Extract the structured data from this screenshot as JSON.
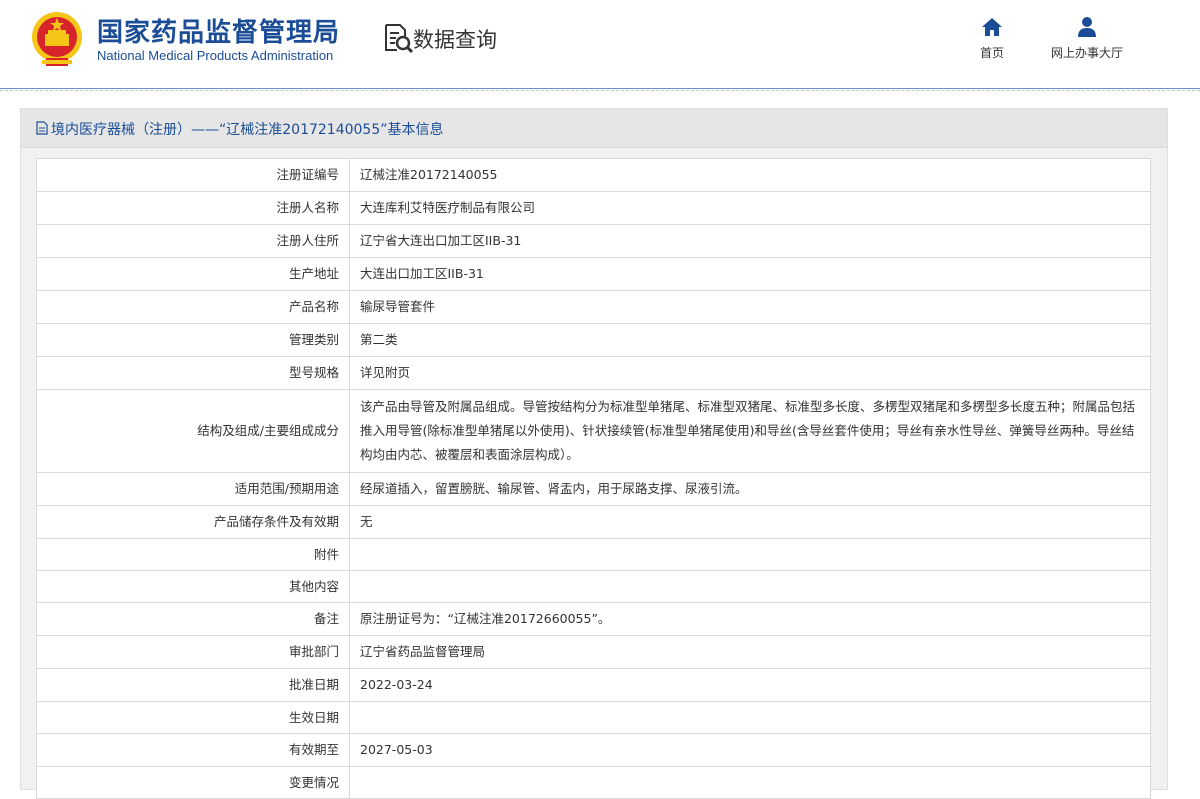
{
  "header": {
    "org_name_cn": "国家药品监督管理局",
    "org_name_en": "National Medical Products Administration",
    "section_title": "数据查询",
    "nav": [
      {
        "label": "首页",
        "icon": "home-icon"
      },
      {
        "label": "网上办事大厅",
        "icon": "user-icon"
      }
    ],
    "colors": {
      "brand": "#1b4d97",
      "emblem_red": "#d8232a",
      "emblem_gold": "#f5c518"
    }
  },
  "panel": {
    "title": "境内医疗器械（注册）——“辽械注准20172140055”基本信息",
    "rows": [
      {
        "label": "注册证编号",
        "value": "辽械注准20172140055"
      },
      {
        "label": "注册人名称",
        "value": "大连库利艾特医疗制品有限公司"
      },
      {
        "label": "注册人住所",
        "value": "辽宁省大连出口加工区IIB-31"
      },
      {
        "label": "生产地址",
        "value": "大连出口加工区IIB-31"
      },
      {
        "label": "产品名称",
        "value": "输尿导管套件"
      },
      {
        "label": "管理类别",
        "value": "第二类"
      },
      {
        "label": "型号规格",
        "value": "详见附页"
      },
      {
        "label": "结构及组成/主要组成成分",
        "value": "该产品由导管及附属品组成。导管按结构分为标准型单猪尾、标准型双猪尾、标准型多长度、多楞型双猪尾和多楞型多长度五种；附属品包括推入用导管(除标准型单猪尾以外使用)、针状接续管(标准型单猪尾使用)和导丝(含导丝套件使用；导丝有亲水性导丝、弹簧导丝两种。导丝结构均由内芯、被覆层和表面涂层构成）。"
      },
      {
        "label": "适用范围/预期用途",
        "value": "经尿道插入，留置膀胱、输尿管、肾盂内，用于尿路支撑、尿液引流。"
      },
      {
        "label": "产品储存条件及有效期",
        "value": "无"
      },
      {
        "label": "附件",
        "value": ""
      },
      {
        "label": "其他内容",
        "value": ""
      },
      {
        "label": "备注",
        "value": "原注册证号为：“辽械注准20172660055”。"
      },
      {
        "label": "审批部门",
        "value": "辽宁省药品监督管理局"
      },
      {
        "label": "批准日期",
        "value": "2022-03-24"
      },
      {
        "label": "生效日期",
        "value": ""
      },
      {
        "label": "有效期至",
        "value": "2027-05-03"
      },
      {
        "label": "变更情况",
        "value": ""
      }
    ]
  }
}
